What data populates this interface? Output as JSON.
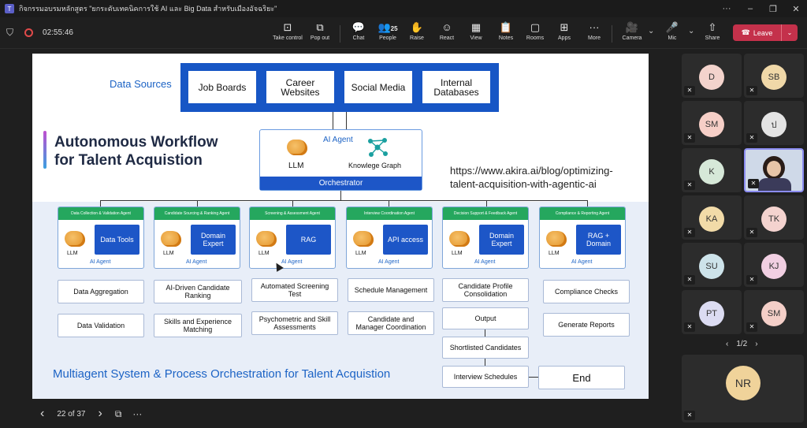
{
  "window": {
    "title": "กิจกรรมอบรมหลักสูตร \"ยกระดับเทคนิคการใช้ AI และ Big Data สำหรับเมืองอัจฉริยะ\"",
    "more": "···",
    "minimize": "–",
    "restore": "❐",
    "close": "✕"
  },
  "toolbar": {
    "timer": "02:55:46",
    "tools": [
      {
        "id": "take-control",
        "label": "Take control",
        "icon": "⊡"
      },
      {
        "id": "pop-out",
        "label": "Pop out",
        "icon": "⧉"
      },
      {
        "id": "chat",
        "label": "Chat",
        "icon": "💬"
      },
      {
        "id": "people",
        "label": "People",
        "icon": "👥",
        "count": "25"
      },
      {
        "id": "raise",
        "label": "Raise",
        "icon": "✋"
      },
      {
        "id": "react",
        "label": "React",
        "icon": "☺"
      },
      {
        "id": "view",
        "label": "View",
        "icon": "▦"
      },
      {
        "id": "notes",
        "label": "Notes",
        "icon": "📋"
      },
      {
        "id": "rooms",
        "label": "Rooms",
        "icon": "▢"
      },
      {
        "id": "apps",
        "label": "Apps",
        "icon": "⊞"
      },
      {
        "id": "more",
        "label": "More",
        "icon": "···"
      },
      {
        "id": "camera",
        "label": "Camera",
        "icon": "🎥"
      },
      {
        "id": "mic",
        "label": "Mic",
        "icon": "🎤"
      },
      {
        "id": "share",
        "label": "Share",
        "icon": "⇧"
      }
    ],
    "leave_label": "Leave",
    "chevron": "⌄"
  },
  "slide": {
    "data_sources_label": "Data Sources",
    "data_sources": [
      "Job Boards",
      "Career Websites",
      "Social Media",
      "Internal Databases"
    ],
    "title_line1": "Autonomous Workflow",
    "title_line2": "for Talent Acquistion",
    "url_line1": "https://www.akira.ai/blog/optimizing-",
    "url_line2": "talent-acquisition-with-agentic-ai",
    "orchestrator": {
      "ai_agent": "AI Agent",
      "llm": "LLM",
      "kg": "Knowlege Graph",
      "bar": "Orchestrator"
    },
    "agents": [
      {
        "header": "Data Collection & Validation Agent",
        "tool": "Data Tools",
        "llm": "LLM",
        "ai": "AI Agent"
      },
      {
        "header": "Candidate Sourcing & Ranking Agent",
        "tool": "Domain Expert",
        "llm": "LLM",
        "ai": "AI Agent"
      },
      {
        "header": "Screening & Assessment Agent",
        "tool": "RAG",
        "llm": "LLM",
        "ai": "AI Agent"
      },
      {
        "header": "Interview Coordination Agent",
        "tool": "API access",
        "llm": "LLM",
        "ai": "AI Agent"
      },
      {
        "header": "Decision Support & Feedback Agent",
        "tool": "Domain Expert",
        "llm": "LLM",
        "ai": "AI Agent"
      },
      {
        "header": "Compliance & Reporting Agent",
        "tool": "RAG + Domain",
        "llm": "LLM",
        "ai": "AI Agent"
      }
    ],
    "tasks": {
      "a1": [
        "Data Aggregation",
        "Data Validation"
      ],
      "a2": [
        "AI-Driven Candidate Ranking",
        "Skills and Experience Matching"
      ],
      "a3": [
        "Automated Screening Test",
        "Psychometric and Skill Assessments"
      ],
      "a4": [
        "Schedule Management",
        "Candidate and Manager Coordination"
      ],
      "a5": [
        "Candidate Profile Consolidation",
        "Output",
        "Shortlisted Candidates",
        "Interview Schedules"
      ],
      "a6": [
        "Compliance Checks",
        "Generate Reports"
      ]
    },
    "bottom_title": "Multiagent System & Process Orchestration for Talent Acquistion",
    "end_label": "End"
  },
  "slide_nav": {
    "prev": "‹",
    "page": "22 of 37",
    "next": "›",
    "grid": "⧉",
    "more": "···"
  },
  "participants": [
    {
      "initials": "D",
      "color": "#f3d3cc"
    },
    {
      "initials": "SB",
      "color": "#f0d8a8"
    },
    {
      "initials": "SM",
      "color": "#f6cfc7"
    },
    {
      "initials": "ป",
      "color": "#e4e4e4"
    },
    {
      "initials": "K",
      "color": "#d6e8d8"
    },
    {
      "initials": "",
      "color": "#cfd9e8"
    },
    {
      "initials": "KA",
      "color": "#f2dba8"
    },
    {
      "initials": "TK",
      "color": "#f4d3cf"
    },
    {
      "initials": "SU",
      "color": "#cde3ea"
    },
    {
      "initials": "KJ",
      "color": "#f1cfe2"
    },
    {
      "initials": "PT",
      "color": "#dcdcf2"
    },
    {
      "initials": "SM",
      "color": "#f4cfc8"
    }
  ],
  "pager": {
    "prev": "‹",
    "label": "1/2",
    "next": "›"
  },
  "featured": {
    "initials": "NR",
    "color": "#f0d39a"
  }
}
